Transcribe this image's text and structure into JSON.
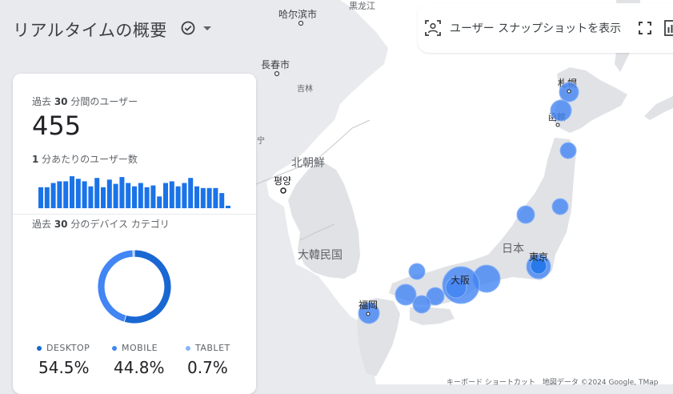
{
  "page": {
    "title": "リアルタイムの概要"
  },
  "toolbar": {
    "snapshot_label": "ユーザー スナップショットを表示"
  },
  "card": {
    "users_label_prefix": "過去 ",
    "users_label_num": "30",
    "users_label_suffix": " 分間のユーザー",
    "users_count": "455",
    "per_minute_label_num": "1",
    "per_minute_label_suffix": " 分あたりのユーザー数",
    "per_minute_values": [
      25,
      25,
      30,
      32,
      32,
      38,
      35,
      32,
      26,
      36,
      25,
      34,
      29,
      37,
      30,
      26,
      30,
      25,
      27,
      14,
      30,
      32,
      26,
      30,
      36,
      26,
      24,
      24,
      24,
      18,
      3
    ],
    "device_label_prefix": "過去 ",
    "device_label_num": "30",
    "device_label_suffix": " 分のデバイス カテゴリ",
    "devices": [
      {
        "name": "DESKTOP",
        "percent": "54.5%",
        "value": 54.5,
        "color": "#1967d2"
      },
      {
        "name": "MOBILE",
        "percent": "44.8%",
        "value": 44.8,
        "color": "#4285f4"
      },
      {
        "name": "TABLET",
        "percent": "0.7%",
        "value": 0.7,
        "color": "#8ab4f8"
      }
    ]
  },
  "map": {
    "labels": {
      "harbin": "哈尔滨市",
      "heilongjiang": "黒龙江",
      "changchun": "長春市",
      "jilin": "吉林",
      "north_korea": "北朝鮮",
      "pyongyang": "평양",
      "south_korea": "大韓民国",
      "japan": "日本",
      "sapporo": "札幌",
      "hakodate": "函館",
      "tokyo": "東京",
      "osaka": "大阪",
      "fukuoka": "福岡",
      "ning": "宁"
    },
    "attribution": "キーボード ショートカット　地図データ ©2024 Google, TMap"
  }
}
